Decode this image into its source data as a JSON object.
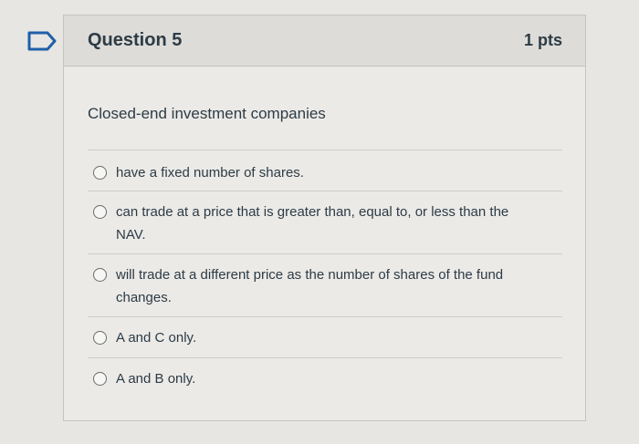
{
  "question": {
    "title": "Question 5",
    "points": "1 pts",
    "text": "Closed-end investment companies"
  },
  "answers": [
    {
      "label": "have a fixed number of shares.",
      "selected": false
    },
    {
      "label": "can trade at a price that is greater than, equal to, or less than the NAV.",
      "selected": false
    },
    {
      "label": "will trade at a different price as the number of shares of the fund changes.",
      "selected": false
    },
    {
      "label": "A and C only.",
      "selected": false
    },
    {
      "label": "A and B only.",
      "selected": false
    }
  ],
  "colors": {
    "bookmark_accent": "#1f5fa8",
    "text": "#2d3b45",
    "header_bg": "#dddcd9",
    "card_bg": "#ebeae7"
  },
  "icons": {
    "bookmark": "bookmark-outline-icon",
    "radio": "radio-unchecked-icon"
  }
}
